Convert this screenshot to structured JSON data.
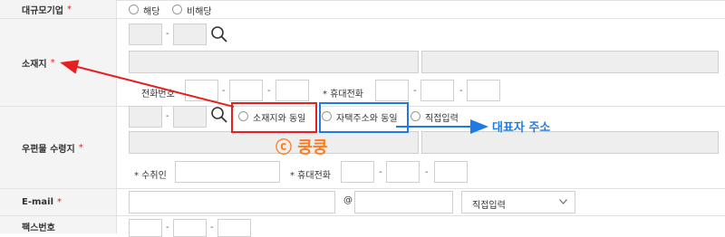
{
  "labels": {
    "large_company": "대규모기업",
    "location": "소재지",
    "mail_address": "우편물 수령지",
    "email": "E-mail",
    "fax": "팩스번호",
    "required_mark": "*"
  },
  "large_company_options": {
    "applicable": "해당",
    "not_applicable": "비해당"
  },
  "location_row": {
    "phone_label": "전화번호",
    "mobile_label": "* 휴대전화"
  },
  "mail_options": {
    "same_as_location": "소재지와 동일",
    "same_as_home": "자택주소와 동일",
    "direct_input": "직접입력"
  },
  "mail_row": {
    "recipient_label": "* 수취인",
    "mobile_label": "* 휴대전화"
  },
  "email_row": {
    "at_sign": "@",
    "domain_select": "직접입력"
  },
  "separator": "-",
  "annotations": {
    "watermark": "ⓒ 쿵쿵",
    "representative_address": "대표자 주소",
    "red_color": "#e62020",
    "blue_color": "#1e7be6",
    "watermark_color": "#ff7a1a"
  }
}
